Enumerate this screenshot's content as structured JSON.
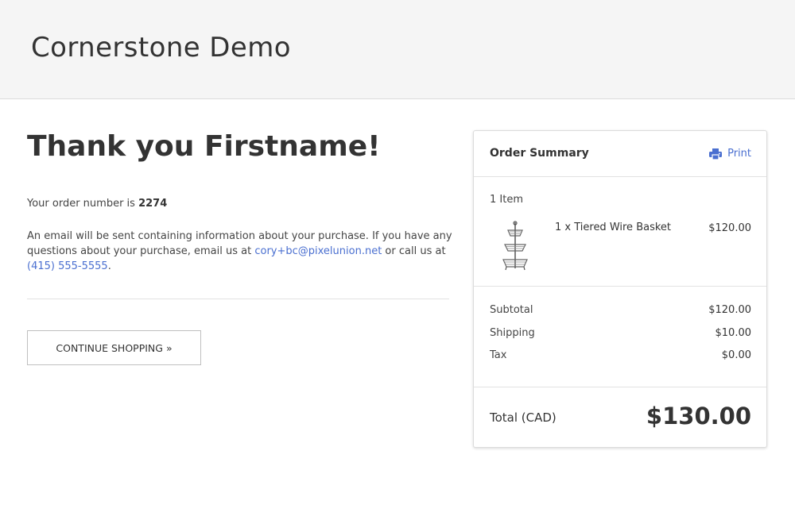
{
  "header": {
    "store_title": "Cornerstone Demo"
  },
  "confirmation": {
    "heading": "Thank you Firstname!",
    "order_prefix": "Your order number is ",
    "order_number": "2274",
    "email_text_1": "An email will be sent containing information about your purchase. If you have any questions about your purchase, email us at ",
    "email_link": "cory+bc@pixelunion.net",
    "email_text_2": " or call us at ",
    "phone_link": "(415) 555-5555",
    "email_text_3": ".",
    "continue_label": "CONTINUE SHOPPING »"
  },
  "summary": {
    "title": "Order Summary",
    "print_label": "Print",
    "print_icon": "printer-icon",
    "items_count": "1 Item",
    "items": [
      {
        "name": "1 x Tiered Wire Basket",
        "price": "$120.00",
        "image_icon": "wire-basket-product-image"
      }
    ],
    "subtotal_label": "Subtotal",
    "subtotal_value": "$120.00",
    "shipping_label": "Shipping",
    "shipping_value": "$10.00",
    "tax_label": "Tax",
    "tax_value": "$0.00",
    "total_label": "Total (CAD)",
    "total_value": "$130.00"
  },
  "colors": {
    "link": "#4a6fd0",
    "header_bg": "#f5f5f5",
    "text": "#333333"
  }
}
